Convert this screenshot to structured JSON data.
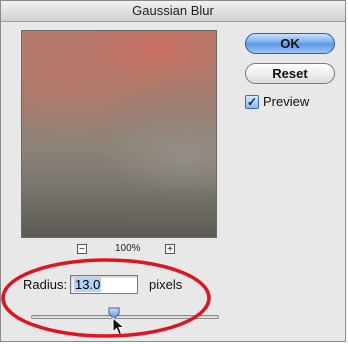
{
  "dialog": {
    "title": "Gaussian Blur"
  },
  "buttons": {
    "ok_label": "OK",
    "reset_label": "Reset"
  },
  "preview": {
    "checkbox_label": "Preview",
    "checked": true
  },
  "zoom": {
    "minus": "−",
    "plus": "+",
    "percent": "100%"
  },
  "radius": {
    "label": "Radius:",
    "value": "13.0",
    "unit": "pixels",
    "slider_fraction": 0.44
  },
  "colors": {
    "ok_button": "#5a96e5",
    "highlight_ellipse": "#e0141e",
    "selection": "#b5d3f7"
  },
  "icons": {
    "cursor": "arrow-pointer-icon",
    "checkmark": "checkmark-icon"
  }
}
